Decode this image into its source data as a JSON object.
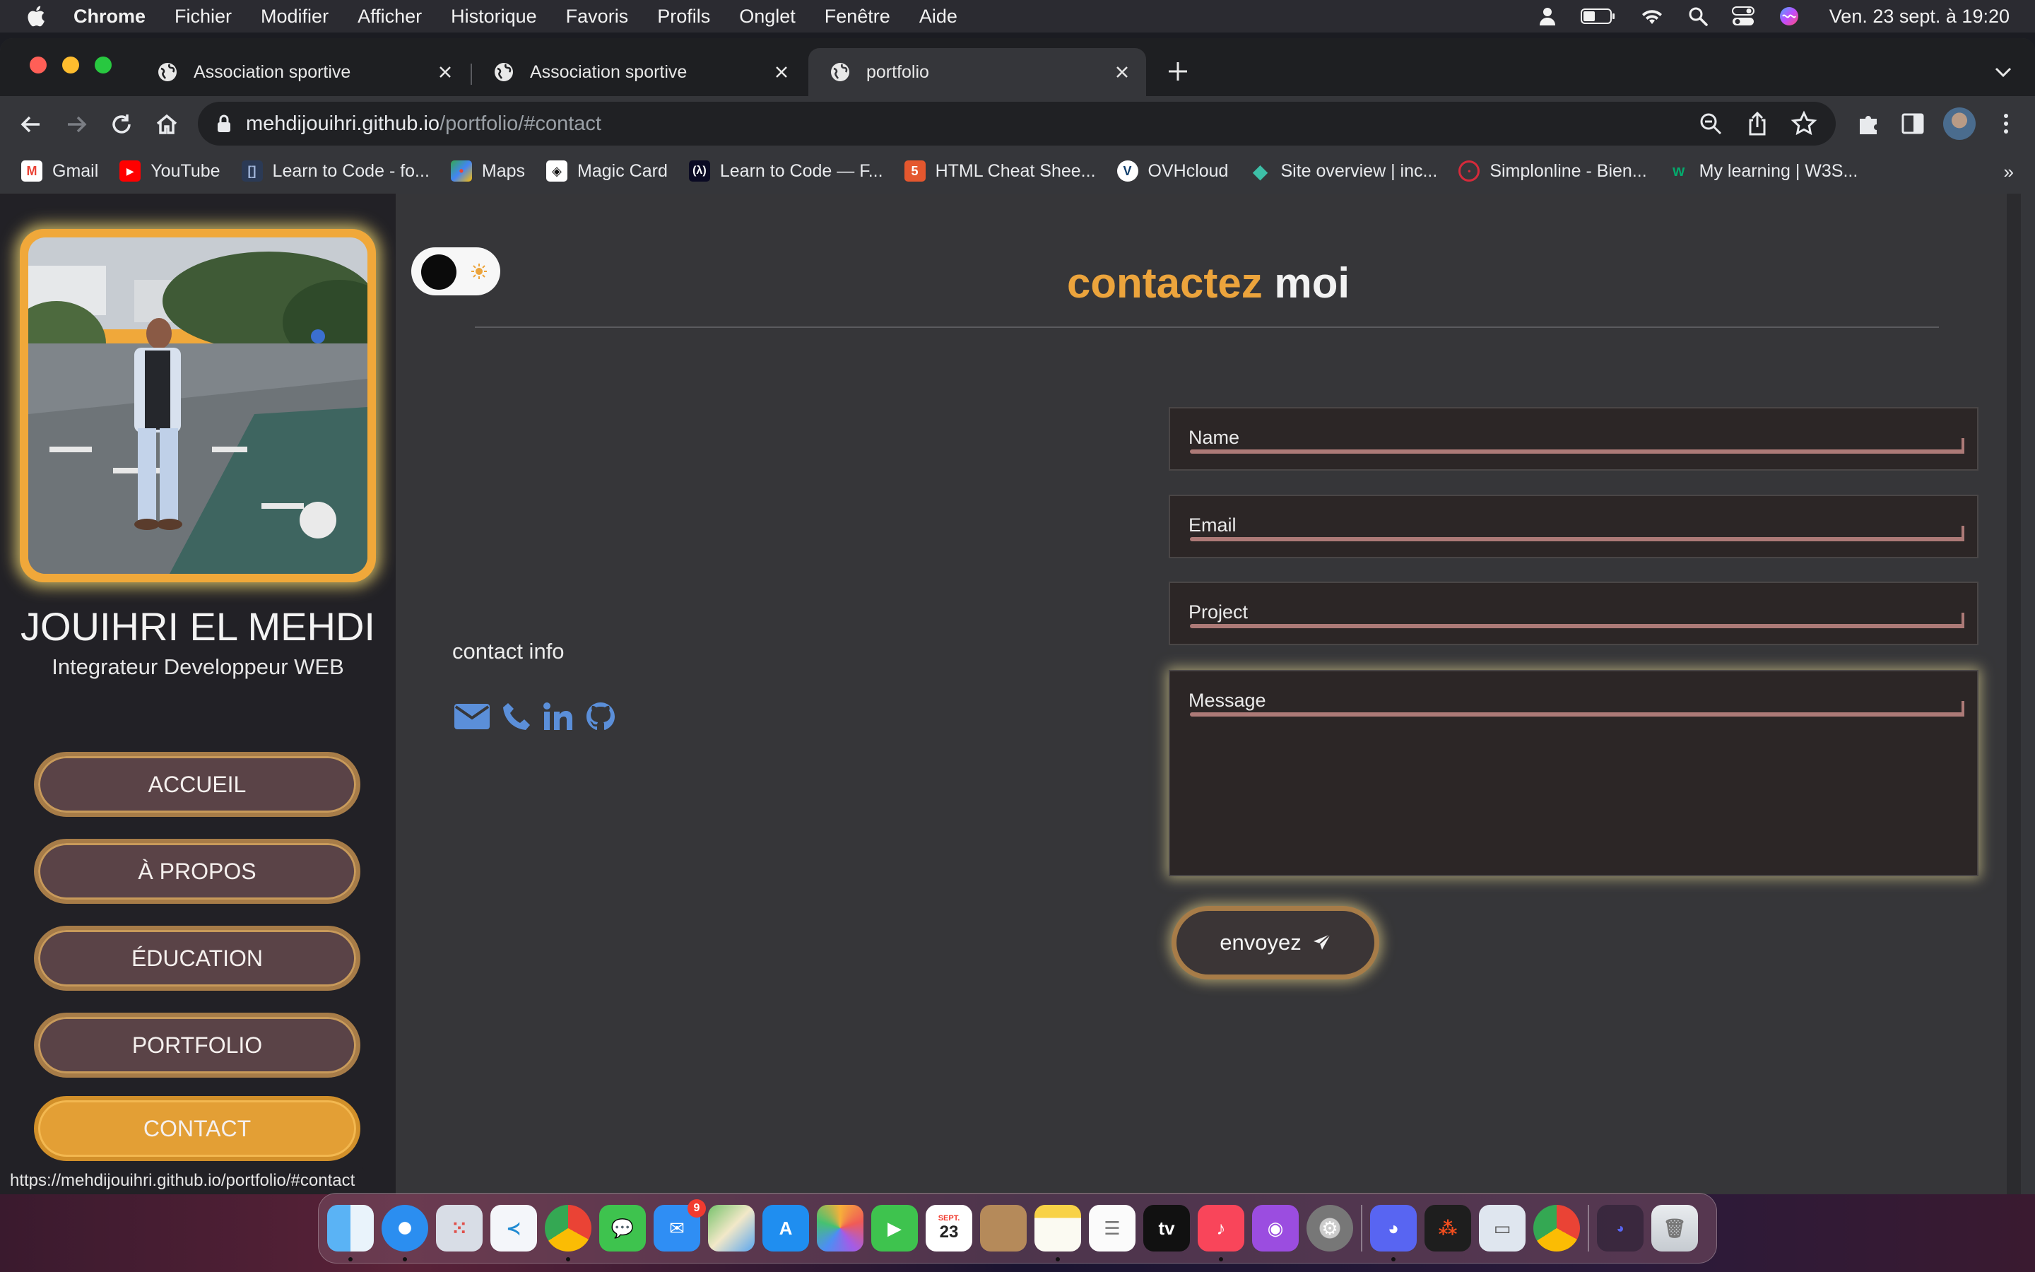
{
  "menubar": {
    "app_name": "Chrome",
    "menus": [
      "Fichier",
      "Modifier",
      "Afficher",
      "Historique",
      "Favoris",
      "Profils",
      "Onglet",
      "Fenêtre",
      "Aide"
    ],
    "clock": "Ven. 23 sept. à  19:20"
  },
  "tabs": [
    {
      "title": "Association sportive",
      "active": false
    },
    {
      "title": "Association sportive",
      "active": false
    },
    {
      "title": "portfolio",
      "active": true
    }
  ],
  "omnibox": {
    "domain": "mehdijouihri.github.io",
    "path": "/portfolio/#contact"
  },
  "bookmarks": [
    {
      "label": "Gmail",
      "icon": "gmail-icon",
      "color": "#ea4335"
    },
    {
      "label": "YouTube",
      "icon": "youtube-icon",
      "color": "#ff0000"
    },
    {
      "label": "Learn to Code - fo...",
      "icon": "freecodecamp-icon",
      "color": "#0a0a23"
    },
    {
      "label": "Maps",
      "icon": "maps-icon",
      "color": "#34a853"
    },
    {
      "label": "Magic Card",
      "icon": "codepen-icon",
      "color": "#ffffff"
    },
    {
      "label": "Learn to Code — F...",
      "icon": "freecodecamp-icon",
      "color": "#0a0a23"
    },
    {
      "label": "HTML Cheat Shee...",
      "icon": "html-icon",
      "color": "#e4572e"
    },
    {
      "label": "OVHcloud",
      "icon": "ovh-icon",
      "color": "#123f6d"
    },
    {
      "label": "Site overview | inc...",
      "icon": "diamond-icon",
      "color": "#3dbfa7"
    },
    {
      "label": "Simplonline - Bien...",
      "icon": "simplon-icon",
      "color": "#d62a3a"
    },
    {
      "label": "My learning | W3S...",
      "icon": "w3schools-icon",
      "color": "#04aa6d"
    }
  ],
  "bookmarks_more": "»",
  "profile": {
    "name": "JOUIHRI EL MEHDI",
    "role": "Integrateur Developpeur WEB"
  },
  "nav": [
    {
      "label": "ACCUEIL",
      "active": false
    },
    {
      "label": "À PROPOS",
      "active": false
    },
    {
      "label": "ÉDUCATION",
      "active": false
    },
    {
      "label": "PORTFOLIO",
      "active": false
    },
    {
      "label": "CONTACT",
      "active": true
    }
  ],
  "status_url": "https://mehdijouihri.github.io/portfolio/#contact",
  "contact": {
    "title_accent": "contactez",
    "title_rest": "moi",
    "info_label": "contact info",
    "social_icons": [
      "envelope-icon",
      "phone-icon",
      "linkedin-icon",
      "github-icon"
    ],
    "fields": {
      "name": "Name",
      "email": "Email",
      "project": "Project",
      "message": "Message"
    },
    "send_label": "envoyez"
  },
  "colors": {
    "accent": "#eca43c",
    "nav_bg": "#5a4347",
    "nav_border": "#a77c48",
    "social_blue": "#5b8fd9",
    "field_bg": "#2c2626",
    "field_line": "#ad7a77"
  },
  "dock": {
    "apps": [
      "finder-icon",
      "safari-icon",
      "launchpad-icon",
      "vscode-icon",
      "chrome-icon",
      "messages-icon",
      "mail-icon",
      "maps-icon",
      "app-store-icon",
      "photos-icon",
      "facetime-icon",
      "calendar-icon",
      "contacts-icon",
      "notes-icon",
      "reminders-icon",
      "apple-tv-icon",
      "music-icon",
      "podcasts-icon",
      "system-settings-icon",
      "discord-icon",
      "figma-icon",
      "preview-icon",
      "chrome-icon",
      "trash-icon"
    ],
    "mail_badge": "9",
    "calendar_month": "SEPT.",
    "calendar_day": "23",
    "tv_label": "tv"
  }
}
